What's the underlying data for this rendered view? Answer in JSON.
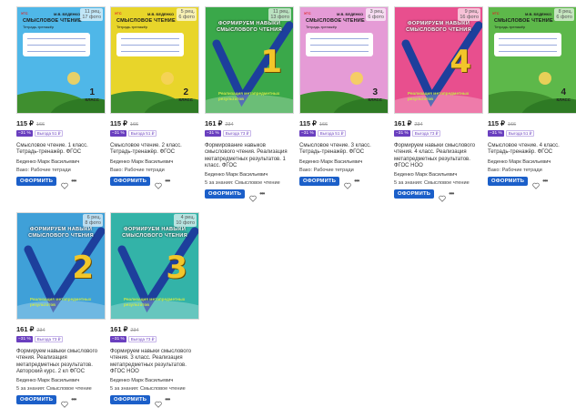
{
  "buy_label": "ОФОРМИТЬ",
  "more_label": "•••",
  "colors": {
    "accent": "#1b5fc9",
    "discount": "#6a3fbf"
  },
  "products": [
    {
      "cover": {
        "badge": "11 рец.\n17 фото",
        "logo": "УГС",
        "series_title": "СМЫСЛОВОЕ ЧТЕНИЕ",
        "subtitle": "Тетрадь-тренажёр",
        "initials": "М.В. БЕДЕНКО",
        "grade": "1",
        "grade_word": "КЛАСС",
        "style": "lined",
        "bg": "#4fb7e8"
      },
      "price": "115 ₽",
      "old_price": "166",
      "discount": "−31 %",
      "win": "Выгода 51 ₽",
      "title": "Смысловое чтение. 1 класс. Тетрадь-тренажёр. ФГОС",
      "author": "Беденко Марк Васильевич",
      "series": "Вако: Рабочие тетради"
    },
    {
      "cover": {
        "badge": "5 рец.\n6 фото",
        "logo": "УГС",
        "series_title": "СМЫСЛОВОЕ ЧТЕНИЕ",
        "subtitle": "Тетрадь-тренажёр",
        "initials": "М.В. БЕДЕНКО",
        "grade": "2",
        "grade_word": "КЛАСС",
        "style": "lined",
        "bg": "#e8d52a"
      },
      "price": "115 ₽",
      "old_price": "166",
      "discount": "−31 %",
      "win": "Выгода 51 ₽",
      "title": "Смысловое чтение. 2 класс. Тетрадь-тренажёр. ФГОС",
      "author": "Беденко Марк Васильевич",
      "series": "Вако: Рабочие тетради"
    },
    {
      "cover": {
        "badge": "11 рец.\n13 фото",
        "big_title": "ФОРМИРУЕМ НАВЫКИ\nСМЫСЛОВОГО ЧТЕНИЯ",
        "digit": "1",
        "sub_title": "Реализация метапредметных результатов",
        "style": "formiruem",
        "bg": "#3aa84a"
      },
      "price": "161 ₽",
      "old_price": "234",
      "discount": "−31 %",
      "win": "Выгода 73 ₽",
      "title": "Формирование навыков смыслового чтения. Реализация метапредметных результатов. 1 класс. ФГОС",
      "author": "Беденко Марк Васильевич",
      "series": "5 за знания: Смысловое чтение"
    },
    {
      "cover": {
        "badge": "3 рец.\n6 фото",
        "logo": "УГС",
        "series_title": "СМЫСЛОВОЕ ЧТЕНИЕ",
        "subtitle": "Тетрадь-тренажёр",
        "initials": "М.В. БЕДЕНКО",
        "grade": "3",
        "grade_word": "КЛАСС",
        "style": "lined",
        "bg": "#e59bd6"
      },
      "price": "115 ₽",
      "old_price": "166",
      "discount": "−31 %",
      "win": "Выгода 51 ₽",
      "title": "Смысловое чтение. 3 класс. Тетрадь-тренажёр. ФГОС",
      "author": "Беденко Марк Васильевич",
      "series": "Вако: Рабочие тетради"
    },
    {
      "cover": {
        "badge": "9 рец.\n16 фото",
        "big_title": "ФОРМИРУЕМ НАВЫКИ\nСМЫСЛОВОГО ЧТЕНИЯ",
        "digit": "4",
        "sub_title": "Реализация метапредметных результатов",
        "style": "formiruem",
        "bg": "#e84f8e"
      },
      "price": "161 ₽",
      "old_price": "234",
      "discount": "−31 %",
      "win": "Выгода 73 ₽",
      "title": "Формируем навыки смыслового чтения. 4 класс. Реализация метапредметных результатов. ФГОС НОО",
      "author": "Беденко Марк Васильевич",
      "series": "5 за знания: Смысловое чтение"
    },
    {
      "cover": {
        "badge": "8 рец.\n6 фото",
        "logo": "УГС",
        "series_title": "СМЫСЛОВОЕ ЧТЕНИЕ",
        "subtitle": "Тетрадь-тренажёр",
        "initials": "М.В. БЕДЕНКО",
        "grade": "4",
        "grade_word": "КЛАСС",
        "style": "lined",
        "bg": "#5db84a"
      },
      "price": "115 ₽",
      "old_price": "166",
      "discount": "−31 %",
      "win": "Выгода 51 ₽",
      "title": "Смысловое чтение. 4 класс. Тетрадь-тренажёр. ФГОС",
      "author": "Беденко Марк Васильевич",
      "series": "Вако: Рабочие тетради"
    },
    {
      "cover": {
        "badge": "6 рец.\n8 фото",
        "big_title": "ФОРМИРУЕМ НАВЫКИ\nСМЫСЛОВОГО ЧТЕНИЯ",
        "digit": "2",
        "sub_title": "Реализация метапредметных результатов",
        "style": "formiruem",
        "bg": "#3fa0d8"
      },
      "price": "161 ₽",
      "old_price": "234",
      "discount": "−31 %",
      "win": "Выгода 73 ₽",
      "title": "Формируем навыки смыслового чтения. Реализация метапредметных результатов. Авторский курс. 2 кл ФГОС",
      "author": "Беденко Марк Васильевич",
      "series": "5 за знания: Смысловое чтение"
    },
    {
      "cover": {
        "badge": "4 рец.\n10 фото",
        "big_title": "ФОРМИРУЕМ НАВЫКИ\nСМЫСЛОВОГО ЧТЕНИЯ",
        "digit": "3",
        "sub_title": "Реализация метапредметных результатов",
        "style": "formiruem",
        "bg": "#33b3a8"
      },
      "price": "161 ₽",
      "old_price": "234",
      "discount": "−31 %",
      "win": "Выгода 73 ₽",
      "title": "Формируем навыки смыслового чтения. 3 класс. Реализация метапредметных результатов. ФГОС НОО",
      "author": "Беденко Марк Васильевич",
      "series": "5 за знания: Смысловое чтение"
    }
  ]
}
